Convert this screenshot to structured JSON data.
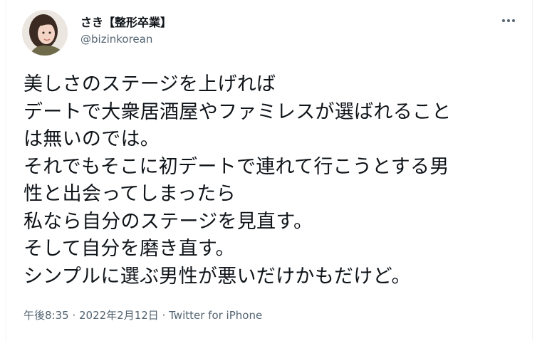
{
  "user": {
    "display_name": "さき【整形卒業】",
    "handle": "@bizinkorean",
    "avatar_icon": "user-avatar-photo"
  },
  "more_icon": "more-dots-icon",
  "tweet": {
    "lines": [
      "美しさのステージを上げれば",
      "デートで大衆居酒屋やファミレスが選ばれること",
      "は無いのでは。",
      "それでもそこに初デートで連れて行こうとする男",
      "性と出会ってしまったら",
      "私なら自分のステージを見直す。",
      "そして自分を磨き直す。",
      "シンプルに選ぶ男性が悪いだけかもだけど。"
    ]
  },
  "meta": {
    "time": "午後8:35",
    "separator": " · ",
    "date": "2022年2月12日",
    "source": "Twitter for iPhone"
  },
  "colors": {
    "text": "#0f1419",
    "secondary": "#536471",
    "border": "#eff3f4"
  }
}
